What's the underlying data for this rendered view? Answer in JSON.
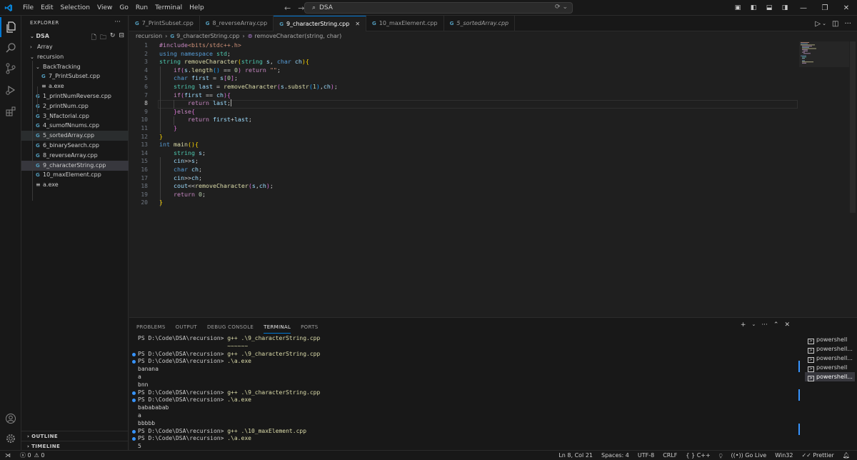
{
  "titlebar": {
    "menu": [
      "File",
      "Edit",
      "Selection",
      "View",
      "Go",
      "Run",
      "Terminal",
      "Help"
    ],
    "search_text": "DSA",
    "back_arrow": "←",
    "forward_arrow": "→"
  },
  "sidebar": {
    "header": "EXPLORER",
    "root": "DSA",
    "items": [
      {
        "label": "Array",
        "kind": "folder-closed",
        "depth": 1
      },
      {
        "label": "recursion",
        "kind": "folder-open",
        "depth": 1
      },
      {
        "label": "BackTracking",
        "kind": "folder-open",
        "depth": 2
      },
      {
        "label": "7_PrintSubset.cpp",
        "kind": "cpp",
        "depth": 3
      },
      {
        "label": "a.exe",
        "kind": "exe",
        "depth": 3
      },
      {
        "label": "1_printNumReverse.cpp",
        "kind": "cpp",
        "depth": 2
      },
      {
        "label": "2_printNum.cpp",
        "kind": "cpp",
        "depth": 2
      },
      {
        "label": "3_Nfactorial.cpp",
        "kind": "cpp",
        "depth": 2
      },
      {
        "label": "4_sumofNnums.cpp",
        "kind": "cpp",
        "depth": 2
      },
      {
        "label": "5_sortedArray.cpp",
        "kind": "cpp",
        "depth": 2
      },
      {
        "label": "6_binarySearch.cpp",
        "kind": "cpp",
        "depth": 2
      },
      {
        "label": "8_reverseArray.cpp",
        "kind": "cpp",
        "depth": 2
      },
      {
        "label": "9_characterString.cpp",
        "kind": "cpp",
        "depth": 2
      },
      {
        "label": "10_maxElement.cpp",
        "kind": "cpp",
        "depth": 2
      },
      {
        "label": "a.exe",
        "kind": "exe",
        "depth": 2
      }
    ],
    "outline": "OUTLINE",
    "timeline": "TIMELINE"
  },
  "tabs": [
    {
      "label": "7_PrintSubset.cpp",
      "active": false,
      "italic": false
    },
    {
      "label": "8_reverseArray.cpp",
      "active": false,
      "italic": false
    },
    {
      "label": "9_characterString.cpp",
      "active": true,
      "italic": false
    },
    {
      "label": "10_maxElement.cpp",
      "active": false,
      "italic": false
    },
    {
      "label": "5_sortedArray.cpp",
      "active": false,
      "italic": true
    }
  ],
  "breadcrumb": {
    "folder": "recursion",
    "file": "9_characterString.cpp",
    "symbol": "removeCharacter(string, char)"
  },
  "editor": {
    "current_line": 8,
    "line_numbers": [
      "1",
      "2",
      "3",
      "4",
      "5",
      "6",
      "7",
      "8",
      "9",
      "10",
      "11",
      "12",
      "13",
      "14",
      "15",
      "16",
      "17",
      "18",
      "19",
      "20"
    ]
  },
  "panel": {
    "tabs": [
      "PROBLEMS",
      "OUTPUT",
      "DEBUG CONSOLE",
      "TERMINAL",
      "PORTS"
    ],
    "active_tab": "TERMINAL",
    "terminal_lines": [
      {
        "text": "PS D:\\Code\\DSA\\recursion> ",
        "cmd": "g++ .\\9_characterString.cpp",
        "dot": false
      },
      {
        "text": "                          ",
        "cmd": "~~~~~~",
        "dot": false
      },
      {
        "text": "PS D:\\Code\\DSA\\recursion> ",
        "cmd": "g++ .\\9_characterString.cpp",
        "dot": true
      },
      {
        "text": "PS D:\\Code\\DSA\\recursion> ",
        "cmd": ".\\a.exe",
        "dot": true
      },
      {
        "text": "banana",
        "cmd": "",
        "dot": false
      },
      {
        "text": "a",
        "cmd": "",
        "dot": false
      },
      {
        "text": "bnn",
        "cmd": "",
        "dot": false
      },
      {
        "text": "PS D:\\Code\\DSA\\recursion> ",
        "cmd": "g++ .\\9_characterString.cpp",
        "dot": true
      },
      {
        "text": "PS D:\\Code\\DSA\\recursion> ",
        "cmd": ".\\a.exe",
        "dot": true
      },
      {
        "text": "babababab",
        "cmd": "",
        "dot": false
      },
      {
        "text": "a",
        "cmd": "",
        "dot": false
      },
      {
        "text": "bbbbb",
        "cmd": "",
        "dot": false
      },
      {
        "text": "PS D:\\Code\\DSA\\recursion> ",
        "cmd": "g++ .\\10_maxElement.cpp",
        "dot": true
      },
      {
        "text": "PS D:\\Code\\DSA\\recursion> ",
        "cmd": ".\\a.exe",
        "dot": true
      },
      {
        "text": "5",
        "cmd": "",
        "dot": false
      }
    ],
    "terminals": [
      "powershell",
      "powershell...",
      "powershell...",
      "powershell",
      "powershell..."
    ],
    "selected_terminal": 4
  },
  "statusbar": {
    "errors": "0",
    "warnings": "0",
    "position": "Ln 8, Col 21",
    "spaces": "Spaces: 4",
    "encoding": "UTF-8",
    "eol": "CRLF",
    "language": "C++",
    "golive": "Go Live",
    "platform": "Win32",
    "prettier": "Prettier"
  },
  "colors": {
    "accent": "#0078d4",
    "keyword": "#569cd6",
    "control": "#c586c0",
    "function": "#dcdcaa",
    "type": "#4ec9b0",
    "string": "#ce9178",
    "number": "#b5cea8",
    "variable": "#9cdcfe"
  }
}
